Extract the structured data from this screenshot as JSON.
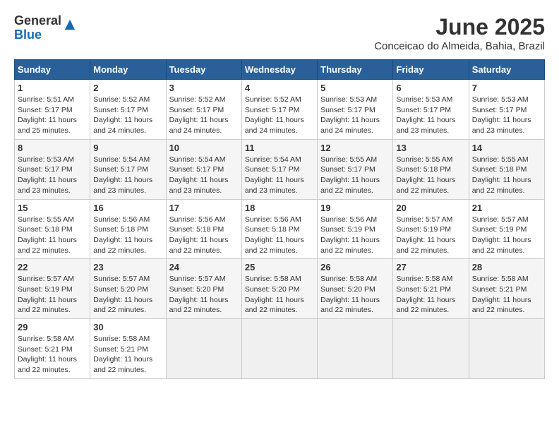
{
  "logo": {
    "general": "General",
    "blue": "Blue"
  },
  "title": "June 2025",
  "subtitle": "Conceicao do Almeida, Bahia, Brazil",
  "headers": [
    "Sunday",
    "Monday",
    "Tuesday",
    "Wednesday",
    "Thursday",
    "Friday",
    "Saturday"
  ],
  "rows": [
    [
      {
        "day": "1",
        "rise": "Sunrise: 5:51 AM",
        "set": "Sunset: 5:17 PM",
        "daylight": "Daylight: 11 hours and 25 minutes."
      },
      {
        "day": "2",
        "rise": "Sunrise: 5:52 AM",
        "set": "Sunset: 5:17 PM",
        "daylight": "Daylight: 11 hours and 24 minutes."
      },
      {
        "day": "3",
        "rise": "Sunrise: 5:52 AM",
        "set": "Sunset: 5:17 PM",
        "daylight": "Daylight: 11 hours and 24 minutes."
      },
      {
        "day": "4",
        "rise": "Sunrise: 5:52 AM",
        "set": "Sunset: 5:17 PM",
        "daylight": "Daylight: 11 hours and 24 minutes."
      },
      {
        "day": "5",
        "rise": "Sunrise: 5:53 AM",
        "set": "Sunset: 5:17 PM",
        "daylight": "Daylight: 11 hours and 24 minutes."
      },
      {
        "day": "6",
        "rise": "Sunrise: 5:53 AM",
        "set": "Sunset: 5:17 PM",
        "daylight": "Daylight: 11 hours and 23 minutes."
      },
      {
        "day": "7",
        "rise": "Sunrise: 5:53 AM",
        "set": "Sunset: 5:17 PM",
        "daylight": "Daylight: 11 hours and 23 minutes."
      }
    ],
    [
      {
        "day": "8",
        "rise": "Sunrise: 5:53 AM",
        "set": "Sunset: 5:17 PM",
        "daylight": "Daylight: 11 hours and 23 minutes."
      },
      {
        "day": "9",
        "rise": "Sunrise: 5:54 AM",
        "set": "Sunset: 5:17 PM",
        "daylight": "Daylight: 11 hours and 23 minutes."
      },
      {
        "day": "10",
        "rise": "Sunrise: 5:54 AM",
        "set": "Sunset: 5:17 PM",
        "daylight": "Daylight: 11 hours and 23 minutes."
      },
      {
        "day": "11",
        "rise": "Sunrise: 5:54 AM",
        "set": "Sunset: 5:17 PM",
        "daylight": "Daylight: 11 hours and 23 minutes."
      },
      {
        "day": "12",
        "rise": "Sunrise: 5:55 AM",
        "set": "Sunset: 5:17 PM",
        "daylight": "Daylight: 11 hours and 22 minutes."
      },
      {
        "day": "13",
        "rise": "Sunrise: 5:55 AM",
        "set": "Sunset: 5:18 PM",
        "daylight": "Daylight: 11 hours and 22 minutes."
      },
      {
        "day": "14",
        "rise": "Sunrise: 5:55 AM",
        "set": "Sunset: 5:18 PM",
        "daylight": "Daylight: 11 hours and 22 minutes."
      }
    ],
    [
      {
        "day": "15",
        "rise": "Sunrise: 5:55 AM",
        "set": "Sunset: 5:18 PM",
        "daylight": "Daylight: 11 hours and 22 minutes."
      },
      {
        "day": "16",
        "rise": "Sunrise: 5:56 AM",
        "set": "Sunset: 5:18 PM",
        "daylight": "Daylight: 11 hours and 22 minutes."
      },
      {
        "day": "17",
        "rise": "Sunrise: 5:56 AM",
        "set": "Sunset: 5:18 PM",
        "daylight": "Daylight: 11 hours and 22 minutes."
      },
      {
        "day": "18",
        "rise": "Sunrise: 5:56 AM",
        "set": "Sunset: 5:18 PM",
        "daylight": "Daylight: 11 hours and 22 minutes."
      },
      {
        "day": "19",
        "rise": "Sunrise: 5:56 AM",
        "set": "Sunset: 5:19 PM",
        "daylight": "Daylight: 11 hours and 22 minutes."
      },
      {
        "day": "20",
        "rise": "Sunrise: 5:57 AM",
        "set": "Sunset: 5:19 PM",
        "daylight": "Daylight: 11 hours and 22 minutes."
      },
      {
        "day": "21",
        "rise": "Sunrise: 5:57 AM",
        "set": "Sunset: 5:19 PM",
        "daylight": "Daylight: 11 hours and 22 minutes."
      }
    ],
    [
      {
        "day": "22",
        "rise": "Sunrise: 5:57 AM",
        "set": "Sunset: 5:19 PM",
        "daylight": "Daylight: 11 hours and 22 minutes."
      },
      {
        "day": "23",
        "rise": "Sunrise: 5:57 AM",
        "set": "Sunset: 5:20 PM",
        "daylight": "Daylight: 11 hours and 22 minutes."
      },
      {
        "day": "24",
        "rise": "Sunrise: 5:57 AM",
        "set": "Sunset: 5:20 PM",
        "daylight": "Daylight: 11 hours and 22 minutes."
      },
      {
        "day": "25",
        "rise": "Sunrise: 5:58 AM",
        "set": "Sunset: 5:20 PM",
        "daylight": "Daylight: 11 hours and 22 minutes."
      },
      {
        "day": "26",
        "rise": "Sunrise: 5:58 AM",
        "set": "Sunset: 5:20 PM",
        "daylight": "Daylight: 11 hours and 22 minutes."
      },
      {
        "day": "27",
        "rise": "Sunrise: 5:58 AM",
        "set": "Sunset: 5:21 PM",
        "daylight": "Daylight: 11 hours and 22 minutes."
      },
      {
        "day": "28",
        "rise": "Sunrise: 5:58 AM",
        "set": "Sunset: 5:21 PM",
        "daylight": "Daylight: 11 hours and 22 minutes."
      }
    ],
    [
      {
        "day": "29",
        "rise": "Sunrise: 5:58 AM",
        "set": "Sunset: 5:21 PM",
        "daylight": "Daylight: 11 hours and 22 minutes."
      },
      {
        "day": "30",
        "rise": "Sunrise: 5:58 AM",
        "set": "Sunset: 5:21 PM",
        "daylight": "Daylight: 11 hours and 22 minutes."
      },
      null,
      null,
      null,
      null,
      null
    ]
  ]
}
